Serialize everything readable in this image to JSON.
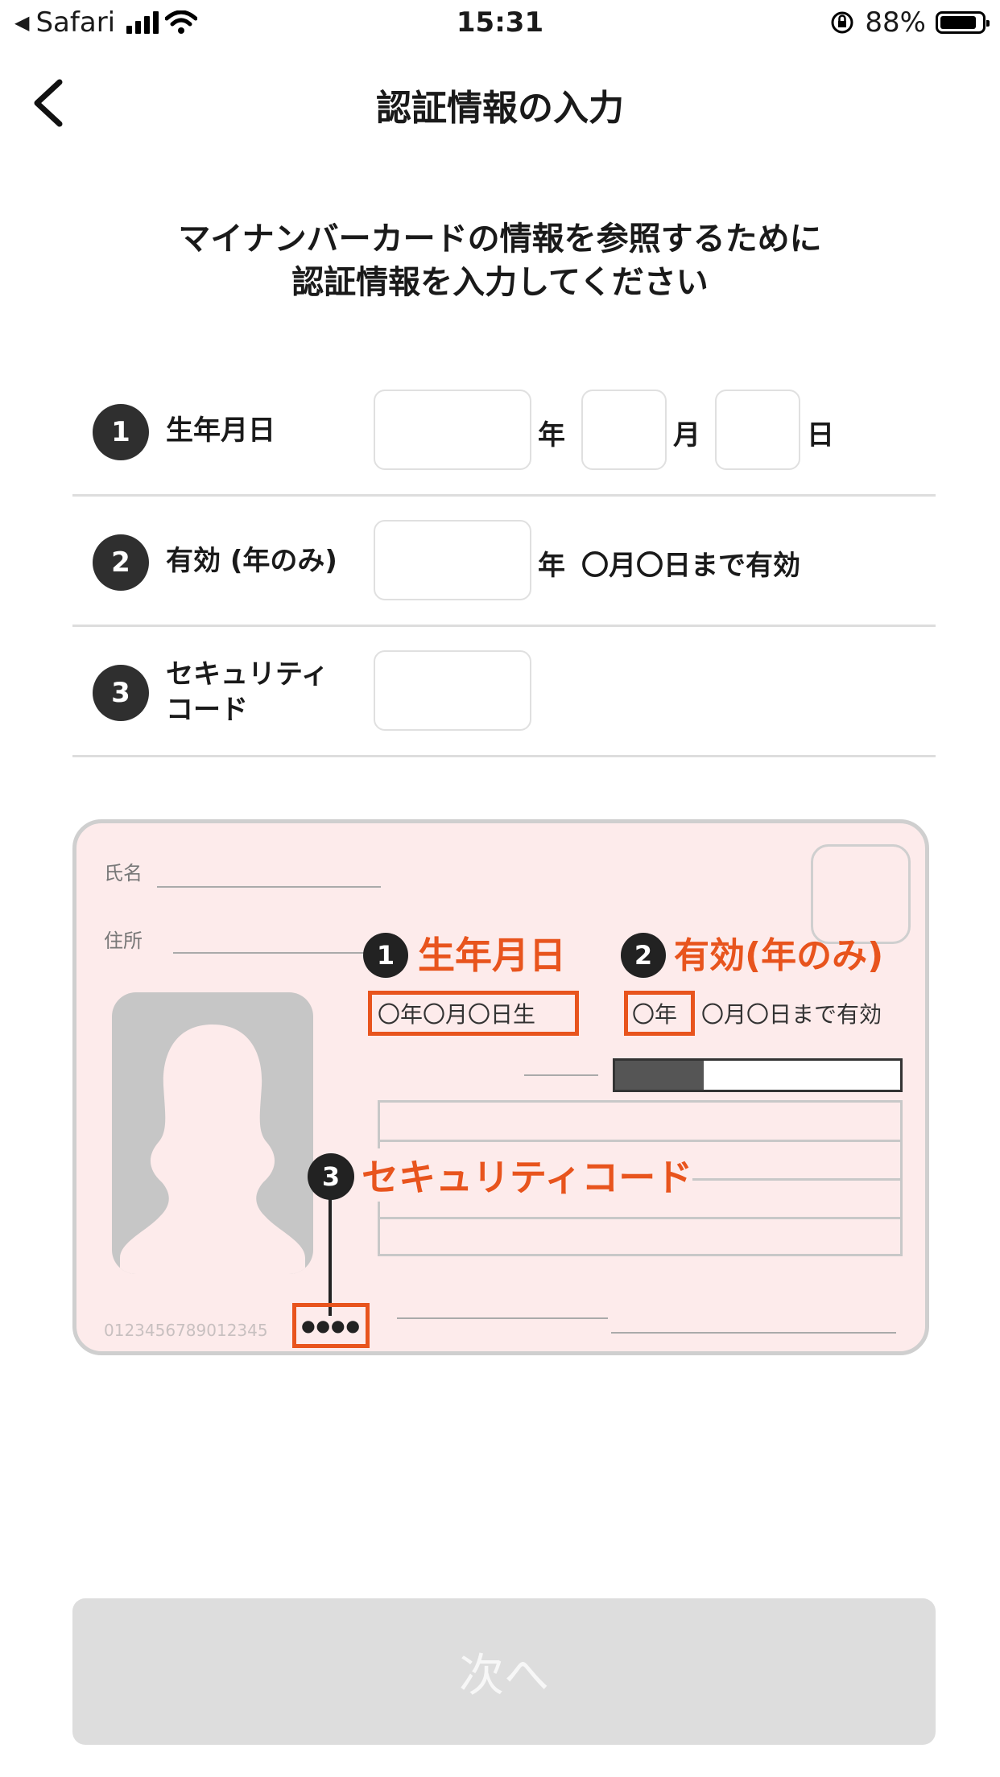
{
  "status_bar": {
    "carrier": "Safari",
    "time": "15:31",
    "battery": "88%",
    "battery_level": 0.88
  },
  "nav": {
    "title": "認証情報の入力"
  },
  "intro": {
    "line1": "マイナンバーカードの情報を参照するために",
    "line2": "認証情報を入力してください"
  },
  "form": {
    "row1": {
      "num": "1",
      "label": "生年月日",
      "unit_year": "年",
      "unit_month": "月",
      "unit_day": "日",
      "year_value": "",
      "month_value": "",
      "day_value": ""
    },
    "row2": {
      "num": "2",
      "label": "有効 (年のみ)",
      "unit_year": "年",
      "suffix": "〇月〇日まで有効",
      "year_value": ""
    },
    "row3": {
      "num": "3",
      "label_line1": "セキュリティ",
      "label_line2": "コード",
      "value": ""
    }
  },
  "card": {
    "name_label": "氏名",
    "address_label": "住所",
    "callout1_num": "1",
    "callout1_text": "生年月日",
    "birth_text": "〇年〇月〇日生",
    "callout2_num": "2",
    "callout2_text": "有効(年のみ)",
    "valid_year": "〇年",
    "valid_suffix": "〇月〇日まで有効",
    "callout3_num": "3",
    "callout3_text": "セキュリティコード",
    "security_dots": "●●●●",
    "card_number": "0123456789012345"
  },
  "next_button": {
    "label": "次へ"
  },
  "colors": {
    "accent": "#e8541d",
    "card_bg": "#fdebeb",
    "button_disabled": "#dddddd"
  }
}
